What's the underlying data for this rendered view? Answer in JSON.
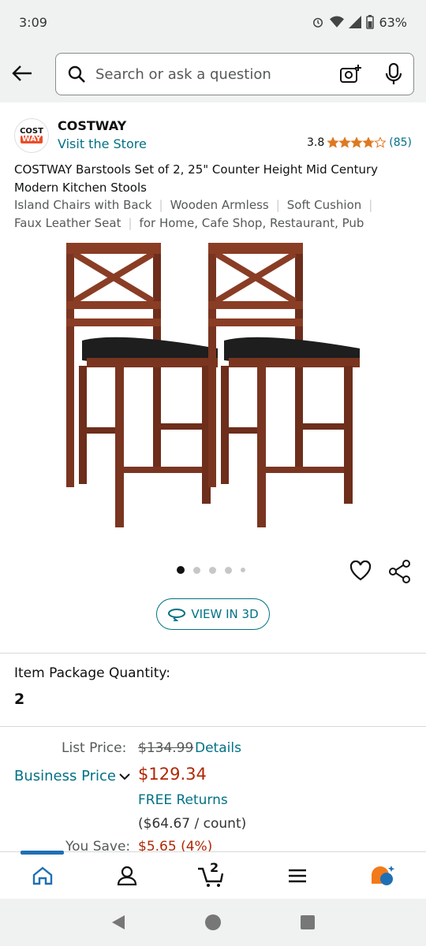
{
  "status": {
    "time": "3:09",
    "battery": "63%"
  },
  "search": {
    "placeholder": "Search or ask a question"
  },
  "brand": {
    "logo_line1": "COST",
    "logo_line2": "WAY",
    "name": "COSTWAY",
    "visit_store": "Visit the Store"
  },
  "rating": {
    "value": "3.8",
    "stars": 3.8,
    "count": "(85)"
  },
  "title": {
    "main": "COSTWAY Barstools Set of 2, 25\" Counter Height Mid Century Modern Kitchen Stools",
    "features": [
      "Island Chairs with Back",
      "Wooden Armless",
      "Soft Cushion",
      "Faux Leather Seat",
      "for Home, Cafe Shop, Restaurant, Pub"
    ]
  },
  "carousel": {
    "total": 5,
    "active": 0
  },
  "view3d": {
    "label": "VIEW IN 3D"
  },
  "quantity": {
    "label": "Item Package Quantity:",
    "value": "2"
  },
  "pricing": {
    "list_price_label": "List Price:",
    "list_price": "$134.99",
    "details": "Details",
    "business_price_label": "Business Price",
    "price": "$129.34",
    "free_returns": "FREE Returns",
    "per_count": "($64.67 / count)",
    "you_save_label": "You Save:",
    "you_save": "$5.65 (4%)"
  },
  "nav": {
    "cart_count": "2"
  },
  "colors": {
    "link": "#007185",
    "price": "#b12704",
    "star": "#de7921",
    "nav_active": "#1f6fb5"
  }
}
